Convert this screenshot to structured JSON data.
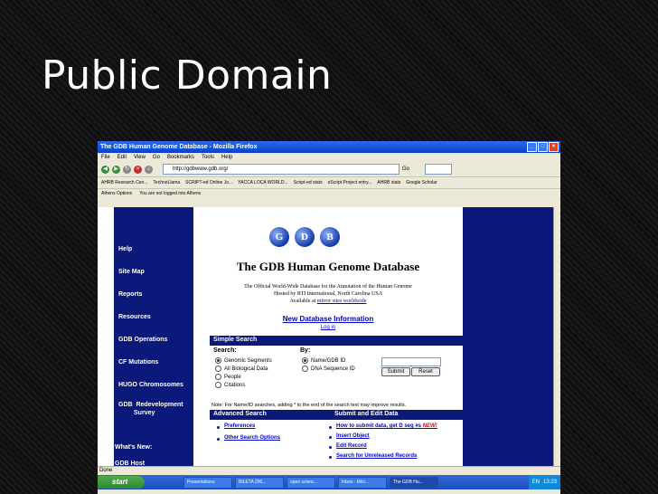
{
  "slide": {
    "title": "Public Domain"
  },
  "browser": {
    "title": "The GDB Human Genome Database - Mozilla Firefox",
    "menu": [
      "File",
      "Edit",
      "View",
      "Go",
      "Bookmarks",
      "Tools",
      "Help"
    ],
    "url": "http://gdbwww.gdb.org/",
    "go_label": "Go",
    "bookmarks": [
      "AHRB Research Cen...",
      "TechnoLlama",
      "SCRIPT-ed Online Jo...",
      "YACCA LOCA WORLD...",
      "Script-ed stats",
      "eScript Project entry...",
      "AHRB stats",
      "Google Scholar"
    ],
    "athens_options": "Athens Options",
    "athens_status": "You are not logged into Athens",
    "status": "Done"
  },
  "gdb": {
    "logo": [
      "G",
      "D",
      "B"
    ],
    "title": "The GDB Human Genome Database",
    "subtitle": "The Official World-Wide Database for the Annotation of the Human Genome",
    "hosted": "Hosted by RTI International, North Carolina USA",
    "available_prefix": "Available at",
    "available_links": "mirror sites worldwide",
    "new_info": "New Database Information",
    "login": "Log in",
    "nav": [
      "Help",
      "Site Map",
      "Reports",
      "Resources",
      "GDB Operations",
      "CF Mutations",
      "HUGO Chromosomes",
      "GDB  Redevelopment",
      "Survey",
      "What's New:",
      "GDB Host"
    ],
    "simple_search": "Simple Search",
    "search_label": "Search:",
    "by_label": "By:",
    "search_options": [
      "Genomic Segments",
      "All Biological Data",
      "People",
      "Citations"
    ],
    "by_options": [
      "Name/GDB ID",
      "DNA Sequence ID"
    ],
    "submit": "Submit",
    "reset": "Reset",
    "note": "Note: For Name/ID searches, adding * to the end of the search text may improve results.",
    "advanced_search": "Advanced Search",
    "submit_edit": "Submit and Edit Data",
    "adv_links": [
      "Preferences",
      "Other Search Options"
    ],
    "edit_links": [
      "How to submit data, get D seg #s",
      "Insert Object",
      "Edit Record",
      "Search for Unreleased Records"
    ],
    "new_badge": "NEW!"
  },
  "taskbar": {
    "start": "start",
    "tasks": [
      "Presentations",
      "BILETA 200...",
      "open scienc...",
      "Inbox - Micr...",
      "The GDB Hu..."
    ],
    "lang": "EN",
    "time": "13:23"
  },
  "colors": {
    "gdb_navy": "#0b1a7a",
    "link_blue": "#0000cc",
    "xp_blue": "#2a6bea"
  }
}
